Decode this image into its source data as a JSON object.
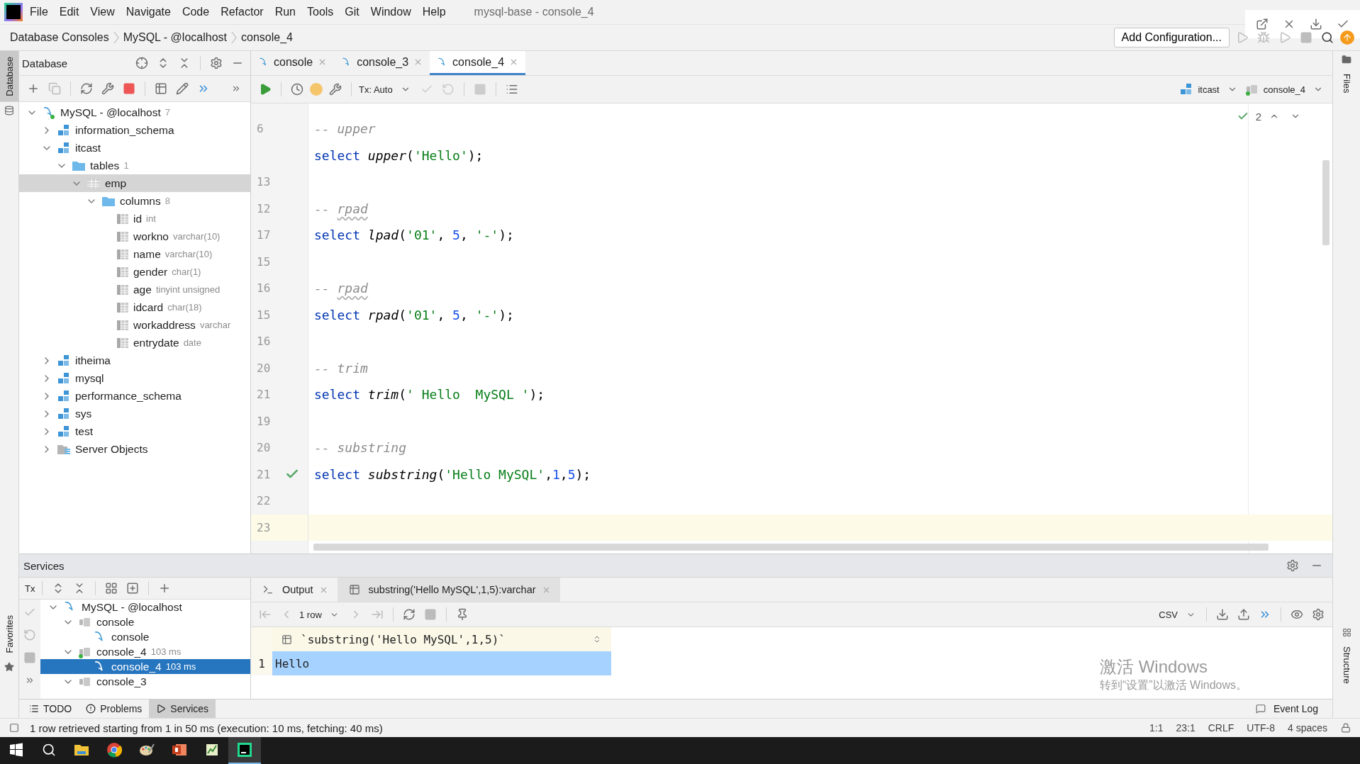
{
  "menu": [
    "File",
    "Edit",
    "View",
    "Navigate",
    "Code",
    "Refactor",
    "Run",
    "Tools",
    "Git",
    "Window",
    "Help"
  ],
  "window_title": "mysql-base - console_4",
  "breadcrumbs": [
    "Database Consoles",
    "MySQL - @localhost",
    "console_4"
  ],
  "add_configuration": "Add Configuration...",
  "left_strip": {
    "database": "Database",
    "favorites": "Favorites"
  },
  "right_strip": [
    "Files",
    "Structure"
  ],
  "database_panel": {
    "title": "Database",
    "tree": [
      {
        "label": "MySQL - @localhost",
        "count": "7",
        "kind": "datasource",
        "connected": true,
        "expanded": true,
        "selected": false,
        "children": [
          {
            "label": "information_schema",
            "kind": "schema",
            "expanded": false,
            "selected": false
          },
          {
            "label": "itcast",
            "kind": "schema",
            "expanded": true,
            "selected": false,
            "children": [
              {
                "label": "tables",
                "count": "1",
                "kind": "folder",
                "expanded": true,
                "selected": false,
                "children": [
                  {
                    "label": "emp",
                    "kind": "table",
                    "expanded": true,
                    "selected": true,
                    "children": [
                      {
                        "label": "columns",
                        "count": "8",
                        "kind": "folder",
                        "expanded": true,
                        "selected": false,
                        "children": [
                          {
                            "label": "id",
                            "detail": "int",
                            "kind": "column",
                            "selected": false
                          },
                          {
                            "label": "workno",
                            "detail": "varchar(10)",
                            "kind": "column",
                            "selected": false
                          },
                          {
                            "label": "name",
                            "detail": "varchar(10)",
                            "kind": "column",
                            "selected": false
                          },
                          {
                            "label": "gender",
                            "detail": "char(1)",
                            "kind": "column",
                            "selected": false
                          },
                          {
                            "label": "age",
                            "detail": "tinyint unsigned",
                            "kind": "column",
                            "selected": false
                          },
                          {
                            "label": "idcard",
                            "detail": "char(18)",
                            "kind": "column",
                            "selected": false
                          },
                          {
                            "label": "workaddress",
                            "detail": "varchar",
                            "kind": "column",
                            "selected": false
                          },
                          {
                            "label": "entrydate",
                            "detail": "date",
                            "kind": "column",
                            "selected": false
                          }
                        ]
                      }
                    ]
                  }
                ]
              }
            ]
          },
          {
            "label": "itheima",
            "kind": "schema",
            "expanded": false,
            "selected": false
          },
          {
            "label": "mysql",
            "kind": "schema",
            "expanded": false,
            "selected": false
          },
          {
            "label": "performance_schema",
            "kind": "schema",
            "expanded": false,
            "selected": false
          },
          {
            "label": "sys",
            "kind": "schema",
            "expanded": false,
            "selected": false
          },
          {
            "label": "test",
            "kind": "schema",
            "expanded": false,
            "selected": false
          },
          {
            "label": "Server Objects",
            "kind": "server",
            "expanded": false,
            "selected": false
          }
        ]
      }
    ]
  },
  "editor": {
    "tabs": [
      {
        "label": "console",
        "selected": false
      },
      {
        "label": "console_3",
        "selected": false
      },
      {
        "label": "console_4",
        "selected": true
      }
    ],
    "tx_mode": "Tx: Auto",
    "schema": "itcast",
    "session": "console_4",
    "inspections": "2",
    "lines": [
      {
        "num": "6",
        "tokens": [
          {
            "t": "-- upper",
            "kind": "comment"
          }
        ]
      },
      {
        "tokens": [
          {
            "t": "select ",
            "kind": "keyword"
          },
          {
            "t": "upper",
            "kind": "function"
          },
          {
            "t": "(",
            "kind": "punct"
          },
          {
            "t": "'Hello'",
            "kind": "string"
          },
          {
            "t": ");",
            "kind": "punct"
          }
        ]
      },
      {
        "num": "13"
      },
      {
        "num": "12",
        "tokens": [
          {
            "t": "-- ",
            "kind": "comment"
          },
          {
            "t": "rpad",
            "kind": "comment",
            "typo": true
          }
        ]
      },
      {
        "num": "17",
        "tokens": [
          {
            "t": "select ",
            "kind": "keyword"
          },
          {
            "t": "lpad",
            "kind": "function"
          },
          {
            "t": "(",
            "kind": "punct"
          },
          {
            "t": "'01'",
            "kind": "string"
          },
          {
            "t": ", ",
            "kind": "punct"
          },
          {
            "t": "5",
            "kind": "number"
          },
          {
            "t": ", ",
            "kind": "punct"
          },
          {
            "t": "'-'",
            "kind": "string"
          },
          {
            "t": ");",
            "kind": "punct"
          }
        ]
      },
      {
        "num": "15"
      },
      {
        "num": "16",
        "tokens": [
          {
            "t": "-- ",
            "kind": "comment"
          },
          {
            "t": "rpad",
            "kind": "comment",
            "typo": true
          }
        ]
      },
      {
        "num": "15",
        "tokens": [
          {
            "t": "select ",
            "kind": "keyword"
          },
          {
            "t": "rpad",
            "kind": "function"
          },
          {
            "t": "(",
            "kind": "punct"
          },
          {
            "t": "'01'",
            "kind": "string"
          },
          {
            "t": ", ",
            "kind": "punct"
          },
          {
            "t": "5",
            "kind": "number"
          },
          {
            "t": ", ",
            "kind": "punct"
          },
          {
            "t": "'-'",
            "kind": "string"
          },
          {
            "t": ");",
            "kind": "punct"
          }
        ]
      },
      {
        "num": "16"
      },
      {
        "num": "20",
        "tokens": [
          {
            "t": "-- trim",
            "kind": "comment"
          }
        ]
      },
      {
        "num": "21",
        "tokens": [
          {
            "t": "select ",
            "kind": "keyword"
          },
          {
            "t": "trim",
            "kind": "function"
          },
          {
            "t": "(",
            "kind": "punct"
          },
          {
            "t": "' Hello  MySQL '",
            "kind": "string"
          },
          {
            "t": ");",
            "kind": "punct"
          }
        ]
      },
      {
        "num": "19"
      },
      {
        "num": "20",
        "tokens": [
          {
            "t": "-- substring",
            "kind": "comment"
          }
        ]
      },
      {
        "num": "21",
        "executed": true,
        "tokens": [
          {
            "t": "select ",
            "kind": "keyword"
          },
          {
            "t": "substring",
            "kind": "function"
          },
          {
            "t": "(",
            "kind": "punct"
          },
          {
            "t": "'Hello MySQL'",
            "kind": "string"
          },
          {
            "t": ",",
            "kind": "punct"
          },
          {
            "t": "1",
            "kind": "number"
          },
          {
            "t": ",",
            "kind": "punct"
          },
          {
            "t": "5",
            "kind": "number"
          },
          {
            "t": ");",
            "kind": "punct"
          }
        ]
      },
      {
        "num": "22"
      },
      {
        "num": "23",
        "current": true
      }
    ]
  },
  "services": {
    "title": "Services",
    "tx": "Tx",
    "tree": [
      {
        "label": "MySQL - @localhost",
        "kind": "datasource",
        "connected": false,
        "expanded": true,
        "selected": false,
        "children": [
          {
            "label": "console",
            "kind": "session",
            "connected": false,
            "expanded": true,
            "selected": false,
            "children": [
              {
                "label": "console",
                "kind": "console",
                "selected": false
              }
            ]
          },
          {
            "label": "console_4",
            "detail": "103 ms",
            "kind": "session",
            "connected": true,
            "expanded": true,
            "selected": false,
            "children": [
              {
                "label": "console_4",
                "detail": "103 ms",
                "kind": "console",
                "selected": true
              }
            ]
          },
          {
            "label": "console_3",
            "kind": "session",
            "connected": false,
            "expanded": true,
            "selected": false
          }
        ]
      }
    ],
    "result_tabs": [
      {
        "label": "Output",
        "kind": "output",
        "selected": false
      },
      {
        "label": "substring('Hello MySQL',1,5):varchar",
        "kind": "grid",
        "selected": true
      }
    ],
    "rows_label": "1 row",
    "format": "CSV",
    "column_header": "`substring('Hello MySQL',1,5)`",
    "rows": [
      {
        "num": "1",
        "value": "Hello",
        "selected": true
      }
    ]
  },
  "activation": {
    "title": "激活 Windows",
    "text": "转到“设置”以激活 Windows。"
  },
  "tool_tabs": [
    {
      "label": "TODO",
      "kind": "todo",
      "selected": false
    },
    {
      "label": "Problems",
      "kind": "problems",
      "selected": false
    },
    {
      "label": "Services",
      "kind": "services",
      "selected": true
    }
  ],
  "event_log": "Event Log",
  "status": {
    "message": "1 row retrieved starting from 1 in 50 ms (execution: 10 ms, fetching: 40 ms)",
    "items": [
      "1:1",
      "23:1",
      "CRLF",
      "UTF-8",
      "4 spaces"
    ]
  }
}
